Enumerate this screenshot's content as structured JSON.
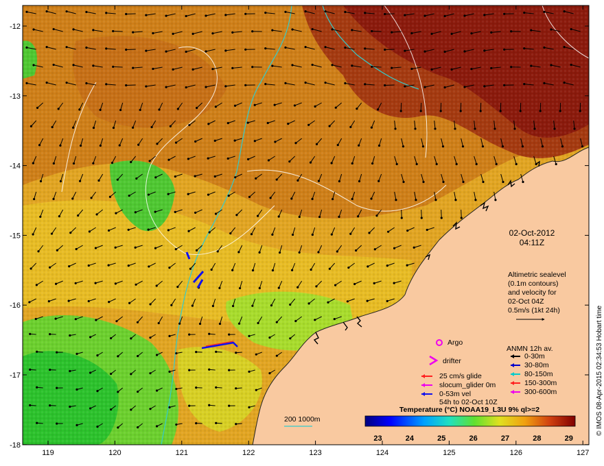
{
  "map": {
    "lon_ticks": [
      "119",
      "120",
      "121",
      "122",
      "123",
      "124",
      "125",
      "126",
      "127"
    ],
    "lat_ticks": [
      "-12",
      "-13",
      "-14",
      "-15",
      "-16",
      "-17",
      "-18"
    ],
    "date": "02-Oct-2012",
    "time": "04:11Z",
    "altimetry": {
      "line1": "Altimetric sealevel",
      "line2": "(0.1m contours)",
      "line3": "and velocity for",
      "line4": "02-Oct 04Z",
      "line5": "0.5m/s (1kt 24h)"
    },
    "legend": {
      "argo": "Argo",
      "drifter": "drifter",
      "glide": "25 cm/s glide",
      "slocum": "slocum_glider 0m",
      "vel": "0-53m vel",
      "vel_period": "54h to 02-Oct 10Z",
      "anmn_title": "ANMN 12h av.",
      "anmn": [
        {
          "label": "0-30m",
          "color": "#000000"
        },
        {
          "label": "30-80m",
          "color": "#0000cc"
        },
        {
          "label": "80-150m",
          "color": "#00cccc"
        },
        {
          "label": "150-300m",
          "color": "#ff2020"
        },
        {
          "label": "300-600m",
          "color": "#ee00ee"
        }
      ]
    },
    "bathy_label": "200  1000m",
    "colorbar": {
      "title": "Temperature (°C) NOAA19_L3U 9% ql>=2",
      "ticks": [
        "23",
        "24",
        "25",
        "26",
        "27",
        "28",
        "29"
      ],
      "range": [
        22.6,
        29.2
      ]
    },
    "credit": "© IMOS 08-Apr-2015 02:34:53 Hobart time",
    "colors": {
      "land": "#f9c9a0",
      "hot": "#8b1a0c",
      "warm": "#cf7a14",
      "mild": "#e6b21c",
      "cool": "#7fd62a",
      "green": "#2cc22c",
      "glide": "#ff2020",
      "slocum": "#ee00ee",
      "vel": "#1010ee",
      "bathy": "#33cccc"
    }
  }
}
